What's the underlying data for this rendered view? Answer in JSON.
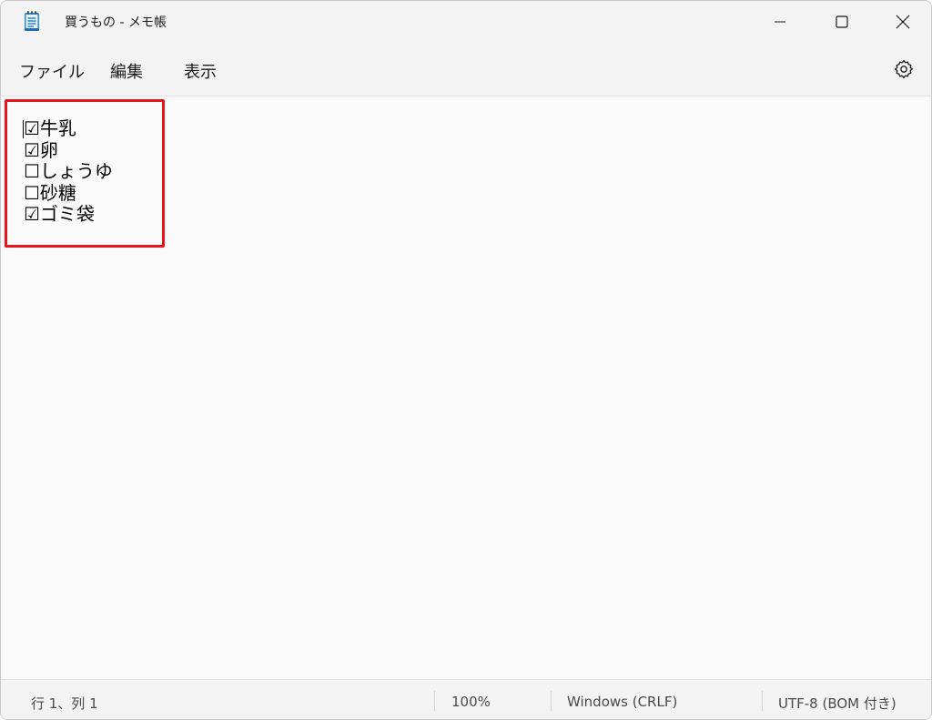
{
  "window": {
    "title": "買うもの - メモ帳",
    "app_icon": "notepad-icon",
    "controls": {
      "minimize_icon": "minimize-icon",
      "maximize_icon": "maximize-icon",
      "close_icon": "close-icon"
    }
  },
  "menu": {
    "file": "ファイル",
    "edit": "編集",
    "view": "表示",
    "settings_icon": "gear-icon"
  },
  "editor": {
    "lines": [
      "☑牛乳",
      "☑卵",
      "☐しょうゆ",
      "☐砂糖",
      "☑ゴミ袋"
    ],
    "highlight_color": "#e8141c"
  },
  "status": {
    "position": "行 1、列 1",
    "zoom": "100%",
    "line_ending": "Windows (CRLF)",
    "encoding": "UTF-8 (BOM 付き)"
  }
}
